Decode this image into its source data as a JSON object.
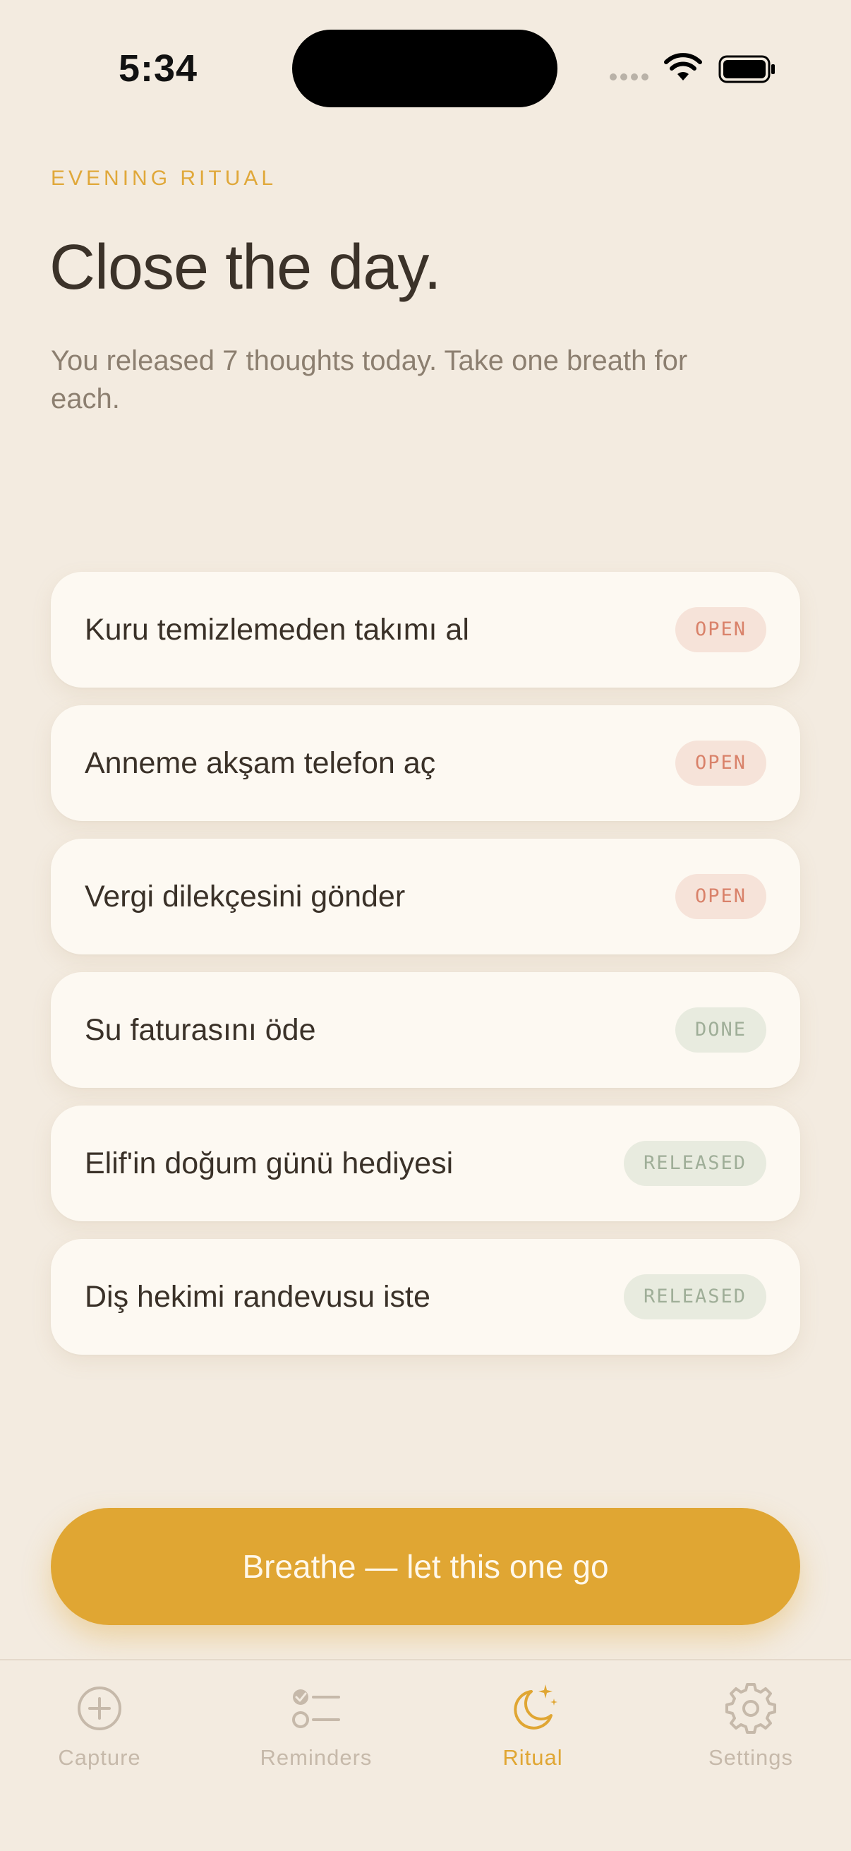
{
  "status_bar": {
    "time": "5:34"
  },
  "header": {
    "eyebrow": "EVENING RITUAL",
    "title": "Close the day.",
    "subtitle": "You released 7 thoughts today. Take one breath for each."
  },
  "items": [
    {
      "label": "Kuru temizlemeden takımı al",
      "status": "OPEN"
    },
    {
      "label": "Anneme akşam telefon aç",
      "status": "OPEN"
    },
    {
      "label": "Vergi dilekçesini gönder",
      "status": "OPEN"
    },
    {
      "label": "Su faturasını öde",
      "status": "DONE"
    },
    {
      "label": "Elif'in doğum günü hediyesi",
      "status": "RELEASED"
    },
    {
      "label": "Diş hekimi randevusu iste",
      "status": "RELEASED"
    }
  ],
  "cta": {
    "label": "Breathe — let this one go"
  },
  "tabs": [
    {
      "label": "Capture",
      "icon": "plus-circle-icon"
    },
    {
      "label": "Reminders",
      "icon": "checklist-icon"
    },
    {
      "label": "Ritual",
      "icon": "moon-sparkle-icon",
      "active": true
    },
    {
      "label": "Settings",
      "icon": "gear-icon"
    }
  ],
  "colors": {
    "accent": "#e0a633",
    "background": "#f3ebe0",
    "open": "#d9826a",
    "done": "#9fae98"
  }
}
